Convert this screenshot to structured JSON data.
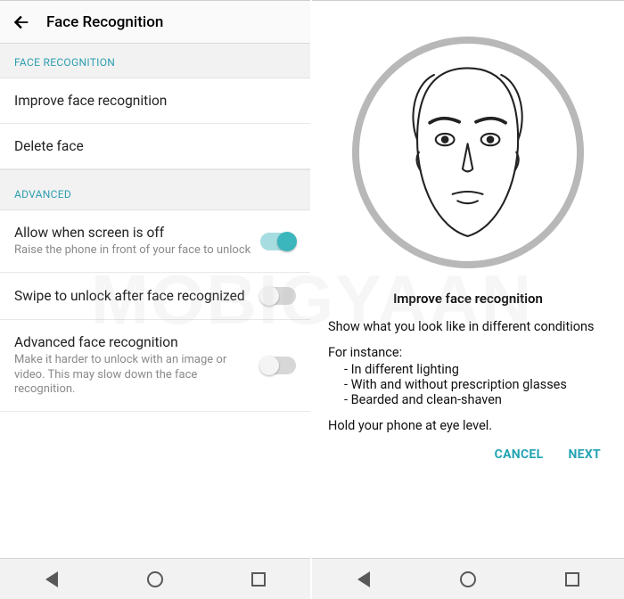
{
  "colors": {
    "accent": "#23a3b3",
    "toggle_on": "#3bb6bd"
  },
  "left": {
    "header_title": "Face Recognition",
    "section1_label": "FACE RECOGNITION",
    "items_simple": [
      {
        "label": "Improve face recognition"
      },
      {
        "label": "Delete face"
      }
    ],
    "section2_label": "ADVANCED",
    "toggles": [
      {
        "label": "Allow when screen is off",
        "sub": "Raise the phone in front of your face to unlock",
        "on": true
      },
      {
        "label": "Swipe to unlock after face recognized",
        "sub": "",
        "on": false
      },
      {
        "label": "Advanced face recognition",
        "sub": "Make it harder to unlock with an image or video. This may slow down the face recognition.",
        "on": false
      }
    ]
  },
  "right": {
    "title": "Improve face recognition",
    "subtitle": "Show what you look like in different conditions",
    "for_label": "For instance:",
    "bullets": [
      "In different lighting",
      "With and without prescription glasses",
      "Bearded and clean-shaven"
    ],
    "hold": "Hold your phone at eye level.",
    "cancel": "CANCEL",
    "next": "NEXT"
  },
  "watermark": "MOBIGYAAN"
}
